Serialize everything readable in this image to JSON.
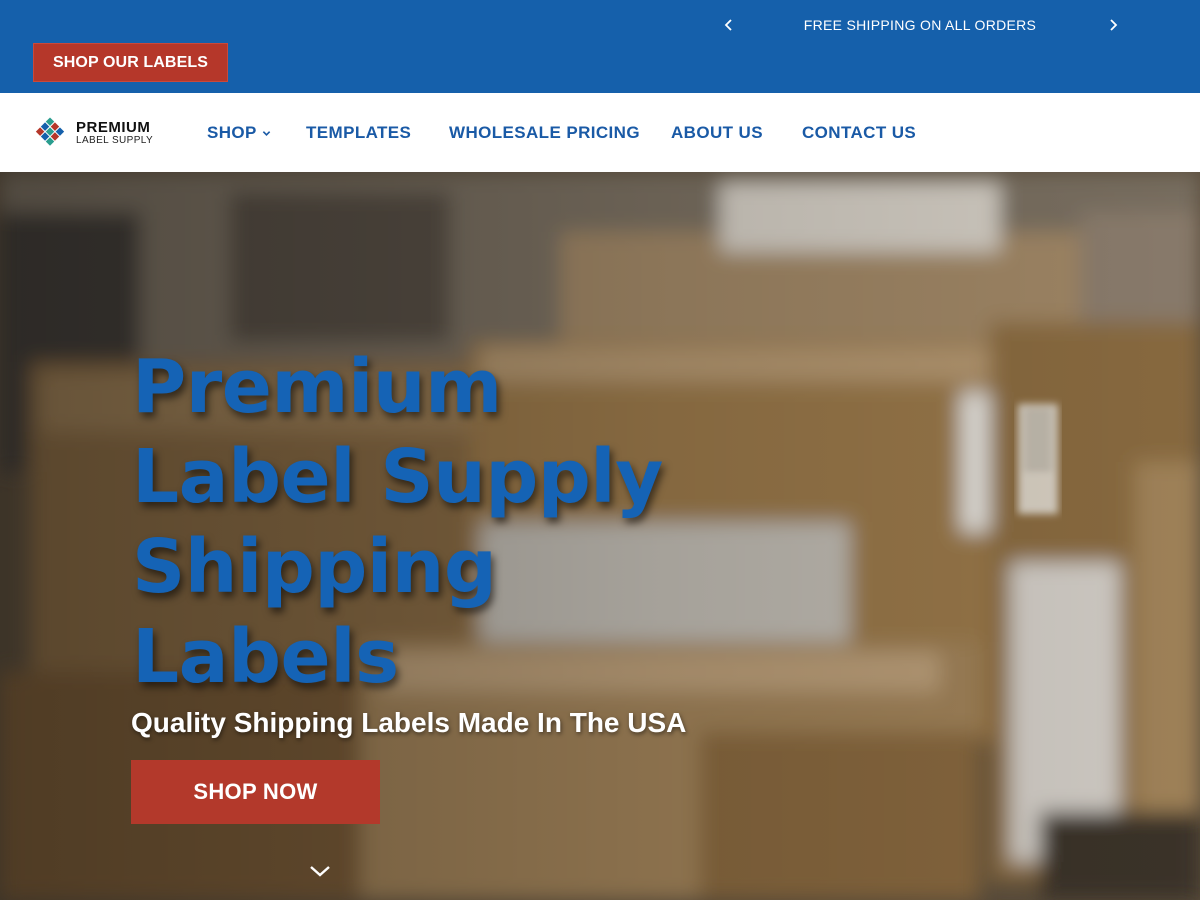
{
  "topbar": {
    "shop_button_label": "SHOP OUR LABELS",
    "announcement": "FREE SHIPPING ON ALL ORDERS",
    "prev_icon": "chevron-left-icon",
    "next_icon": "chevron-right-icon",
    "background_color": "#1560ab"
  },
  "header": {
    "logo": {
      "line1": "PREMIUM",
      "line2": "LABEL SUPPLY",
      "colors": [
        "#1560ab",
        "#b5372a",
        "#2a9d8f"
      ]
    },
    "nav": [
      {
        "label": "SHOP",
        "has_dropdown": true
      },
      {
        "label": "TEMPLATES"
      },
      {
        "label": "WHOLESALE PRICING"
      },
      {
        "label": "ABOUT US"
      },
      {
        "label": "CONTACT US"
      }
    ],
    "nav_color": "#1a5aa6"
  },
  "hero": {
    "title_lines": [
      "Premium",
      "Label Supply",
      "Shipping",
      "Labels"
    ],
    "subtitle": "Quality Shipping Labels Made In The USA",
    "cta_label": "SHOP NOW",
    "scroll_icon": "chevron-down-icon",
    "title_color": "#1563b5",
    "cta_color": "#b3392b"
  }
}
